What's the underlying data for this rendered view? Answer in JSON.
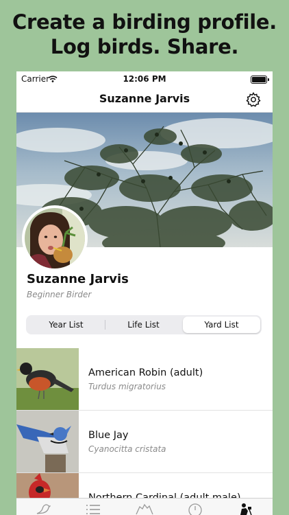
{
  "headline": {
    "line1": "Create a birding profile.",
    "line2": "Log birds. Share."
  },
  "status_bar": {
    "carrier": "Carrier",
    "time": "12:06 PM",
    "wifi_icon": "wifi-icon",
    "battery_icon": "battery-icon"
  },
  "nav": {
    "title": "Suzanne Jarvis",
    "settings_icon": "gear-icon"
  },
  "profile": {
    "name": "Suzanne Jarvis",
    "level": "Beginner Birder"
  },
  "segments": {
    "items": [
      "Year List",
      "Life List",
      "Yard List"
    ],
    "selected": "Yard List"
  },
  "birds": [
    {
      "common": "American Robin (adult)",
      "scientific": "Turdus migratorius"
    },
    {
      "common": "Blue Jay",
      "scientific": "Cyanocitta cristata"
    },
    {
      "common": "Northern Cardinal (adult male)",
      "scientific": ""
    }
  ],
  "tabs": [
    "bird-icon",
    "list-icon",
    "map-icon",
    "compass-icon",
    "birder-icon"
  ],
  "colors": {
    "background": "#9ec59a",
    "accent": "#111111"
  }
}
